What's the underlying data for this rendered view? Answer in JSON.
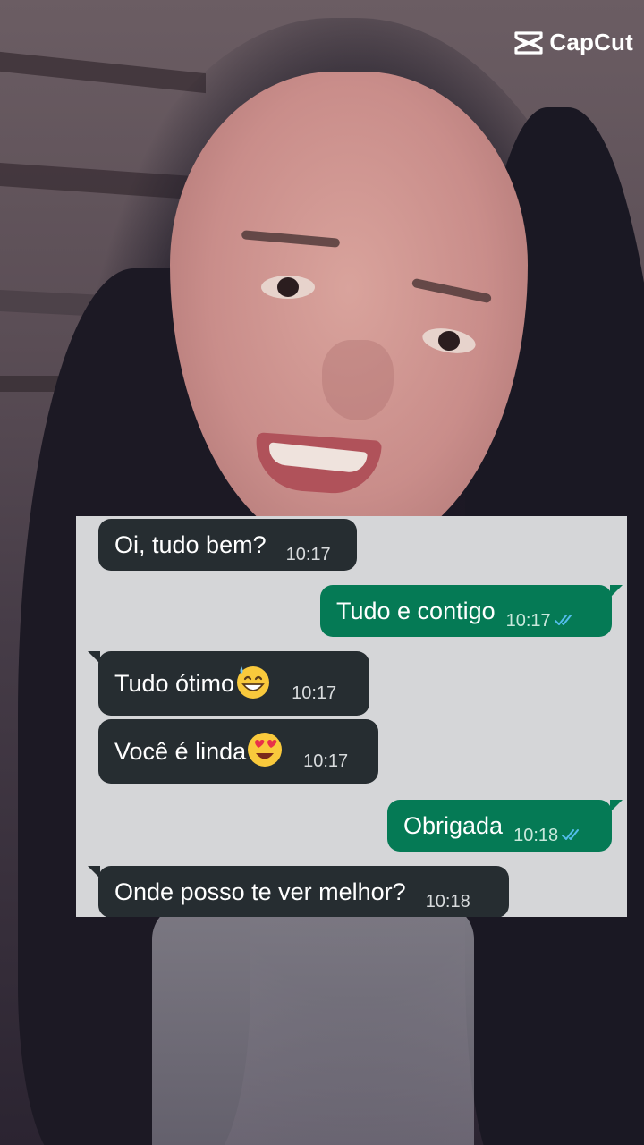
{
  "watermark": {
    "brand": "CapCut",
    "icon": "capcut-logo-icon"
  },
  "chat": {
    "colors": {
      "background": "#d5d6d8",
      "incoming": "#262d31",
      "outgoing": "#057a55",
      "read_ticks": "#53bdeb"
    },
    "messages": [
      {
        "direction": "in",
        "text": "Oi, tudo bem?",
        "time": "10:17"
      },
      {
        "direction": "out",
        "text": "Tudo e contigo",
        "time": "10:17",
        "status_icon": "double-check-icon"
      },
      {
        "direction": "in",
        "text": "Tudo ótimo",
        "emoji": "grinning-sweat-emoji",
        "time": "10:17"
      },
      {
        "direction": "in",
        "text": "Você é linda",
        "emoji": "heart-eyes-emoji",
        "time": "10:17"
      },
      {
        "direction": "out",
        "text": "Obrigada",
        "time": "10:18",
        "status_icon": "double-check-icon"
      },
      {
        "direction": "in",
        "text": "Onde posso te ver melhor?",
        "time": "10:18"
      }
    ]
  }
}
